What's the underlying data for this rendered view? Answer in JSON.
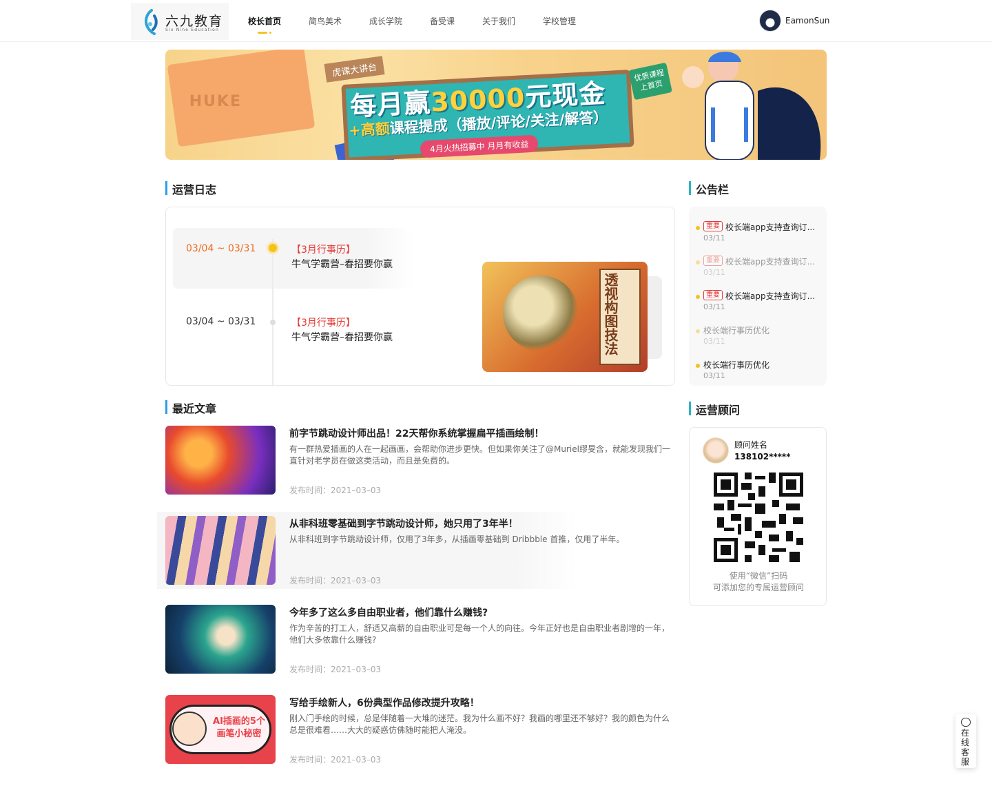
{
  "header": {
    "logo_cn": "六九教育",
    "logo_en": "Six Nine Education",
    "nav": [
      "校长首页",
      "简鸟美术",
      "成长学院",
      "备受课",
      "关于我们",
      "学校管理"
    ],
    "active_nav": "校长首页",
    "username": "EamonSun"
  },
  "banner": {
    "tag": "虎课大讲台",
    "title_prefix": "每月赢",
    "title_number": "30000",
    "title_suffix": "元现金",
    "subtitle_hl": "+高额",
    "subtitle": "课程提成（播放/评论/关注/解答）",
    "pill": "4月火热招募中 月月有收益",
    "stamp_line1": "优质课程",
    "stamp_line2": "上首页",
    "book_text": "HUKE"
  },
  "ops_log": {
    "title": "运营日志",
    "entries": [
      {
        "date": "03/04 ~ 03/31",
        "tag": "【3月行事历】",
        "text": "牛气学霸营–春招要你赢",
        "active": true
      },
      {
        "date": "03/04 ~ 03/31",
        "tag": "【3月行事历】",
        "text": "牛气学霸营–春招要你赢",
        "active": false
      }
    ],
    "cover_text": "透视构图技法"
  },
  "articles": {
    "title": "最近文章",
    "date_prefix": "发布时间：",
    "items": [
      {
        "title": "前字节跳动设计师出品！22天帮你系统掌握扁平插画绘制！",
        "desc": "有一群热爱插画的人在一起画画，会帮助你进步更快。但如果你关注了@Muriel缪旻含，就能发现我们一直针对老学员在做这类活动，而且是免费的。",
        "date": "2021–03–03"
      },
      {
        "title": "从非科班零基础到字节跳动设计师，她只用了3年半！",
        "desc": "从非科班到字节跳动设计师，仅用了3年多，从插画零基础到 Dribbble 首推，仅用了半年。",
        "date": "2021–03–03"
      },
      {
        "title": "今年多了这么多自由职业者，他们靠什么赚钱?",
        "desc": "作为辛苦的打工人，舒适又高薪的自由职业可是每一个人的向往。今年正好也是自由职业者剧增的一年，他们大多依靠什么赚钱?",
        "date": "2021–03–03"
      },
      {
        "title": "写给手绘新人，6份典型作品修改提升攻略！",
        "desc": "刚入门手绘的时候，总是伴随着一大堆的迷茫。我为什么画不好？我画的哪里还不够好？我的颜色为什么总是很难看……大大的疑惑仿佛随时能把人淹没。",
        "date": "2021–03–03",
        "thumb_text": "AI插画的5个画笔小秘密"
      }
    ]
  },
  "notices": {
    "title": "公告栏",
    "items": [
      {
        "badge": "重要",
        "title": "校长端app支持查询订...",
        "date": "03/11",
        "faded": false
      },
      {
        "badge": "重要",
        "title": "校长端app支持查询订...",
        "date": "03/11",
        "faded": true
      },
      {
        "badge": "重要",
        "title": "校长端app支持查询订...",
        "date": "03/11",
        "faded": false
      },
      {
        "badge": "",
        "title": "校长端行事历优化",
        "date": "03/11",
        "faded": true
      },
      {
        "badge": "",
        "title": "校长端行事历优化",
        "date": "03/11",
        "faded": false
      }
    ]
  },
  "advisor": {
    "title": "运营顾问",
    "name": "顾问姓名",
    "phone": "138102*****",
    "tip1": "使用“微信”扫码",
    "tip2": "可添加您的专属运营顾问"
  },
  "service": {
    "label": "在线客服"
  },
  "colors": {
    "accent_yellow": "#f5c21c",
    "active_date": "#f06a1c",
    "tag_red": "#e53935",
    "section_bar_blue": "#2d9ce6",
    "section_bar_teal": "#2db3c1"
  },
  "icons": [
    "logo-mark-icon",
    "user-avatar-icon",
    "chat-bubble-icon",
    "qr-code-icon"
  ]
}
